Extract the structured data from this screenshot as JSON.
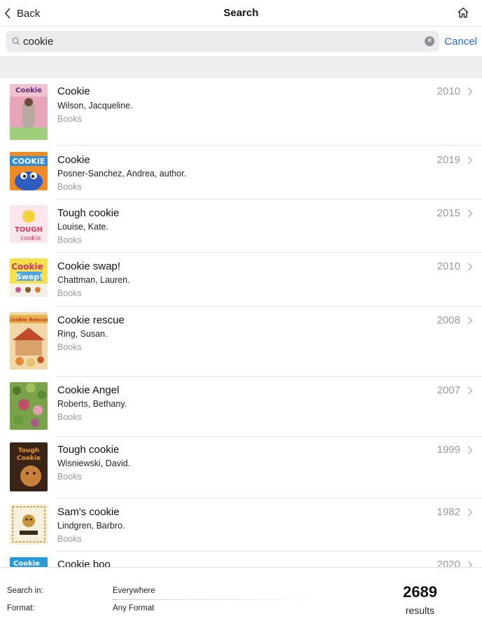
{
  "nav": {
    "back_label": "Back",
    "title": "Search",
    "back_icon": "chevron-left-icon",
    "home_icon": "home-icon"
  },
  "search": {
    "value": "cookie",
    "cancel_label": "Cancel",
    "clear_icon": "clear-icon",
    "search_icon": "search-icon"
  },
  "results": [
    {
      "title": "Cookie",
      "author": "Wilson, Jacqueline.",
      "format": "Books",
      "year": "2010"
    },
    {
      "title": "Cookie",
      "author": "Posner-Sanchez, Andrea, author.",
      "format": "Books",
      "year": "2019"
    },
    {
      "title": "Tough cookie",
      "author": "Louise, Kate.",
      "format": "Books",
      "year": "2015"
    },
    {
      "title": "Cookie swap!",
      "author": "Chattman, Lauren.",
      "format": "Books",
      "year": "2010"
    },
    {
      "title": "Cookie rescue",
      "author": "Ring, Susan.",
      "format": "Books",
      "year": "2008"
    },
    {
      "title": "Cookie Angel",
      "author": "Roberts, Bethany.",
      "format": "Books",
      "year": "2007"
    },
    {
      "title": "Tough cookie",
      "author": "Wisniewski, David.",
      "format": "Books",
      "year": "1999"
    },
    {
      "title": "Sam's cookie",
      "author": "Lindgren, Barbro.",
      "format": "Books",
      "year": "1982"
    },
    {
      "title": "Cookie boo",
      "author": "",
      "format": "",
      "year": "2020"
    }
  ],
  "footer": {
    "search_in_label": "Search in:",
    "search_in_value": "Everywhere",
    "format_label": "Format:",
    "format_value": "Any Format",
    "count": "2689",
    "count_label": "results"
  },
  "colors": {
    "accent": "#2f6bd6",
    "separator": "#e5e5e5",
    "muted": "#9a9a9a",
    "band": "#efeff2"
  }
}
